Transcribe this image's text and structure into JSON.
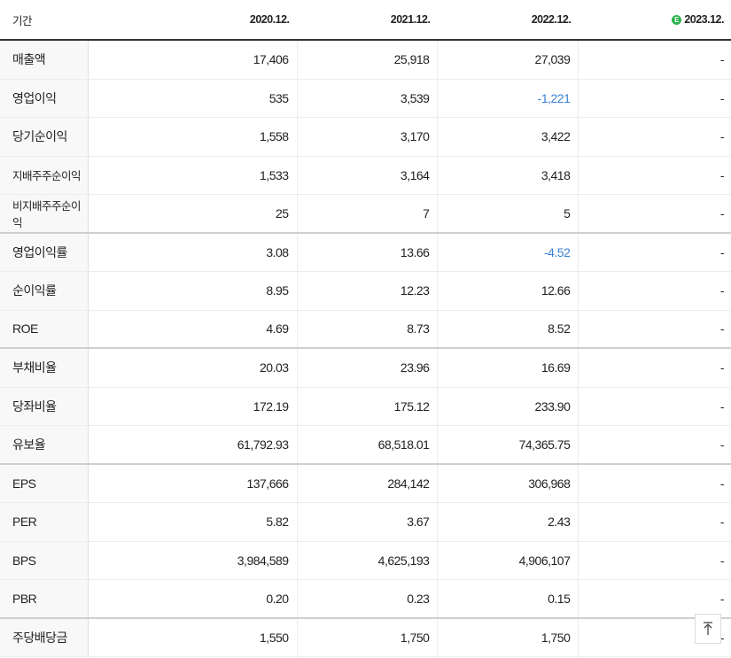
{
  "header": {
    "period_label": "기간",
    "columns": [
      "2020.12.",
      "2021.12.",
      "2022.12.",
      "2023.12."
    ],
    "estimate_badge": "E"
  },
  "rows": [
    {
      "label": "매출액",
      "values": [
        "17,406",
        "25,918",
        "27,039",
        "-"
      ]
    },
    {
      "label": "영업이익",
      "values": [
        "535",
        "3,539",
        "-1,221",
        "-"
      ]
    },
    {
      "label": "당기순이익",
      "values": [
        "1,558",
        "3,170",
        "3,422",
        "-"
      ]
    },
    {
      "label": "지배주주순이익",
      "values": [
        "1,533",
        "3,164",
        "3,418",
        "-"
      ]
    },
    {
      "label": "비지배주주순이익",
      "values": [
        "25",
        "7",
        "5",
        "-"
      ]
    },
    {
      "label": "영업이익률",
      "values": [
        "3.08",
        "13.66",
        "-4.52",
        "-"
      ]
    },
    {
      "label": "순이익률",
      "values": [
        "8.95",
        "12.23",
        "12.66",
        "-"
      ]
    },
    {
      "label": "ROE",
      "values": [
        "4.69",
        "8.73",
        "8.52",
        "-"
      ]
    },
    {
      "label": "부채비율",
      "values": [
        "20.03",
        "23.96",
        "16.69",
        "-"
      ]
    },
    {
      "label": "당좌비율",
      "values": [
        "172.19",
        "175.12",
        "233.90",
        "-"
      ]
    },
    {
      "label": "유보율",
      "values": [
        "61,792.93",
        "68,518.01",
        "74,365.75",
        "-"
      ]
    },
    {
      "label": "EPS",
      "values": [
        "137,666",
        "284,142",
        "306,968",
        "-"
      ]
    },
    {
      "label": "PER",
      "values": [
        "5.82",
        "3.67",
        "2.43",
        "-"
      ]
    },
    {
      "label": "BPS",
      "values": [
        "3,984,589",
        "4,625,193",
        "4,906,107",
        "-"
      ]
    },
    {
      "label": "PBR",
      "values": [
        "0.20",
        "0.23",
        "0.15",
        "-"
      ]
    },
    {
      "label": "주당배당금",
      "values": [
        "1,550",
        "1,750",
        "1,750",
        "-"
      ]
    }
  ],
  "colors": {
    "negative": "#3a7fd5",
    "estimate_badge": "#2bb24c"
  },
  "scroll_top_icon": "arrow-up-to-top-icon"
}
